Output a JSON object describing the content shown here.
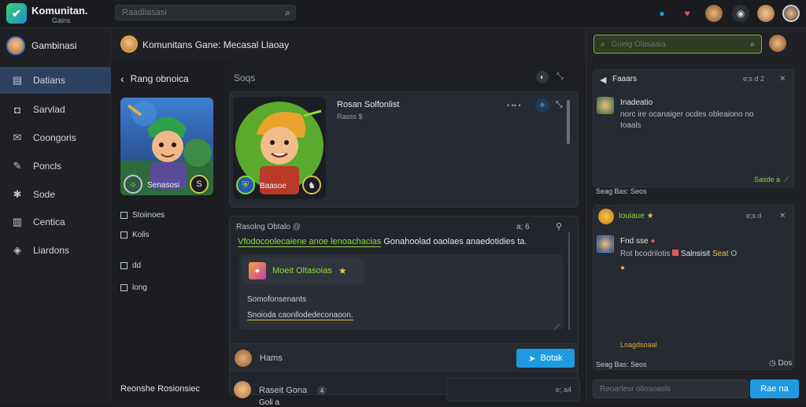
{
  "topbar": {
    "brand": "Komunitan.",
    "brand_sub": "Gains",
    "search_placeholder": "Raadiiasasi",
    "icons": [
      "search-icon",
      "notification-icon",
      "dot-icon",
      "avatar-1",
      "avatar-2",
      "avatar-3",
      "avatar-4"
    ]
  },
  "sidebar": {
    "user_name": "Gambinasi",
    "items": [
      {
        "label": "Datians",
        "icon": "home-icon",
        "active": true
      },
      {
        "label": "Sarvlad",
        "icon": "camera-icon",
        "active": false
      },
      {
        "label": "Coongoris",
        "icon": "mail-icon",
        "active": false
      },
      {
        "label": "Poncls",
        "icon": "edit-icon",
        "active": false
      },
      {
        "label": "Sode",
        "icon": "gear-icon",
        "active": false
      },
      {
        "label": "Centica",
        "icon": "book-icon",
        "active": false
      },
      {
        "label": "Liardons",
        "icon": "layers-icon",
        "active": false
      }
    ]
  },
  "header2": {
    "title": "Komunitans Gane: Mecasal Llaoay"
  },
  "left_col": {
    "back_label": "Rang obnoica",
    "hero_caption": "Senasosi",
    "hero_badge": "S",
    "list": [
      "Stoiinoes",
      "Kolis",
      "dd",
      "long"
    ],
    "footer": "Reonshe Rosionsiec"
  },
  "center": {
    "sub_head": "Soqs",
    "profile": {
      "name": "Rosan Solfonlist",
      "meta": "Rasss $",
      "caption": "Baasoe",
      "controls": "• •• •"
    },
    "post": {
      "author": "Rasolng Obtalo",
      "author_meta": "@",
      "head_controls": "a; 6",
      "headline_green": "Vfodocoolecaiene anoe lenoachacias",
      "headline_white": "Gonahoolad oaolaes anaedotidies ta.",
      "tag_label": "Moeit Oltasoias",
      "line1": "Somofonsenants",
      "line2": "Snoioda caonllodedeconaoon."
    },
    "composer": {
      "label": "Hams",
      "button": "Botak"
    },
    "bottom": {
      "name": "Raseit Gona",
      "badge": "4",
      "sub": "Goli a",
      "panel_text": "e; a4"
    }
  },
  "right": {
    "search_placeholder": "Goeig Olasaaia",
    "panel1": {
      "title": "Faaars",
      "controls": "e;s d 2",
      "user": "Inadeatio",
      "message": "norc ire ocanaiger ocdes obleaiono no Ioaals",
      "green_meta": "Sasde a",
      "footer": "Seag Bas: Seos"
    },
    "panel2": {
      "title": "Iouiaue",
      "controls": "e;s d",
      "user": "Fnd sse",
      "line_a": "Rot bcodrilotis",
      "line_b": "Salnsisit",
      "line_c": "Seat",
      "line_d": "O",
      "green_meta": "Loagdsoaal",
      "footer": "Seag Bas: Seos",
      "footer_right": "Dos"
    },
    "input_placeholder": "Reoarlesr oliosoasls",
    "send_button": "Rae na"
  },
  "colors": {
    "accent": "#1f9ae0",
    "active_nav": "#2d4160",
    "green": "#8ddc3a",
    "yellow": "#e8c54a"
  }
}
